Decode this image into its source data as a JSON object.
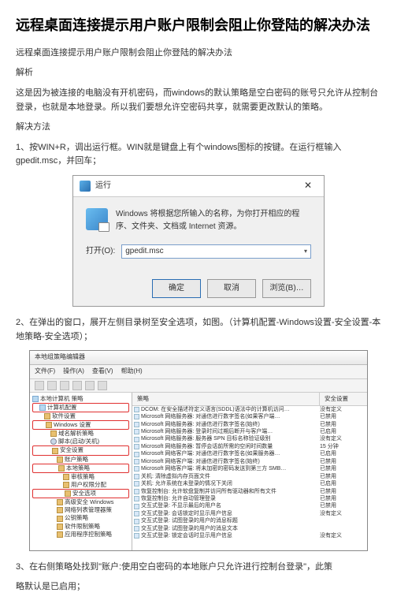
{
  "title": "远程桌面连接提示用户账户限制会阻止你登陆的解决办法",
  "subtitle": "远程桌面连接提示用户账户限制会阻止你登陆的解决办法",
  "section_analysis_label": "解析",
  "analysis_text": "这是因为被连接的电脑没有开机密码，而windows的默认策略是空白密码的账号只允许从控制台登录，也就是本地登录。所以我们要想允许空密码共享，就需要更改默认的策略。",
  "section_solution_label": "解决方法",
  "step1": "1、按WIN+R，调出运行框。WIN就是键盘上有个windows图标的按键。在运行框输入gpedit.msc，并回车；",
  "run_dialog": {
    "title": "运行",
    "message": "Windows 将根据您所输入的名称，为你打开相应的程序、文件夹、文档或 Internet 资源。",
    "open_label": "打开(O):",
    "input_value": "gpedit.msc",
    "btn_ok": "确定",
    "btn_cancel": "取消",
    "btn_browse": "浏览(B)…"
  },
  "step2": "2、在弹出的窗口，展开左侧目录树至安全选项，如图。（计算机配置-Windows设置-安全设置-本地策略-安全选项）；",
  "gpedit": {
    "title": "本地组策略编辑器",
    "menu": [
      "文件(F)",
      "操作(A)",
      "查看(V)",
      "帮助(H)"
    ],
    "tree": {
      "root": "本地计算机 策略",
      "n1": "计算机配置",
      "n1a": "软件设置",
      "n1b": "Windows 设置",
      "n1b1": "域名解析策略",
      "n1b2": "脚本(启动/关机)",
      "n1b3": "安全设置",
      "n1b3a": "账户策略",
      "n1b3b": "本地策略",
      "n1b3b1": "审核策略",
      "n1b3b2": "用户权限分配",
      "n1b3b3": "安全选项",
      "n1b3c": "高级安全 Windows",
      "n1b3d": "网络列表管理器策",
      "n1b3e": "公钥策略",
      "n1b3f": "软件限制策略",
      "n1b3g": "应用程序控制策略"
    },
    "col_policy": "策略",
    "col_setting": "安全设置",
    "rows": [
      {
        "p": "DCOM: 在安全描述符定义语言(SDDL)语法中的计算机访问…",
        "s": "没有定义"
      },
      {
        "p": "Microsoft 网络服务器: 对通信进行数字签名(如果客户端…",
        "s": "已禁用"
      },
      {
        "p": "Microsoft 网络服务器: 对通信进行数字签名(始终)",
        "s": "已禁用"
      },
      {
        "p": "Microsoft 网络服务器: 登录时间过期后断开与客户端…",
        "s": "已启用"
      },
      {
        "p": "Microsoft 网络服务器: 服务器 SPN 目标名称验证级别",
        "s": "没有定义"
      },
      {
        "p": "Microsoft 网络服务器: 暂停会话前所需的空闲时间数量",
        "s": "15 分钟"
      },
      {
        "p": "Microsoft 网络客户端: 对通信进行数字签名(如果服务器…",
        "s": "已启用"
      },
      {
        "p": "Microsoft 网络客户端: 对通信进行数字签名(始终)",
        "s": "已禁用"
      },
      {
        "p": "Microsoft 网络客户端: 将未加密的密码发送到第三方 SMB…",
        "s": "已禁用"
      },
      {
        "p": "关机: 清除虚拟内存页面文件",
        "s": "已禁用"
      },
      {
        "p": "关机: 允许系统在未登录的情况下关闭",
        "s": "已启用"
      },
      {
        "p": "恢复控制台: 允许软盘复制并访问所有驱动器和所有文件",
        "s": "已禁用"
      },
      {
        "p": "恢复控制台: 允许自动管理登录",
        "s": "已禁用"
      },
      {
        "p": "交互式登录: 不显示最后的用户名",
        "s": "已禁用"
      },
      {
        "p": "交互式登录: 会话锁定时显示用户信息",
        "s": "没有定义"
      },
      {
        "p": "交互式登录: 试图登录的用户的消息标题",
        "s": ""
      },
      {
        "p": "交互式登录: 试图登录的用户的消息文本",
        "s": ""
      },
      {
        "p": "交互式登录: 锁定会话时显示用户信息",
        "s": "没有定义"
      }
    ]
  },
  "step3a": "3、在右侧策略处找到\"账户:使用空白密码的本地账户只允许进行控制台登录\"，此策",
  "step3b": "略默认是已启用；"
}
